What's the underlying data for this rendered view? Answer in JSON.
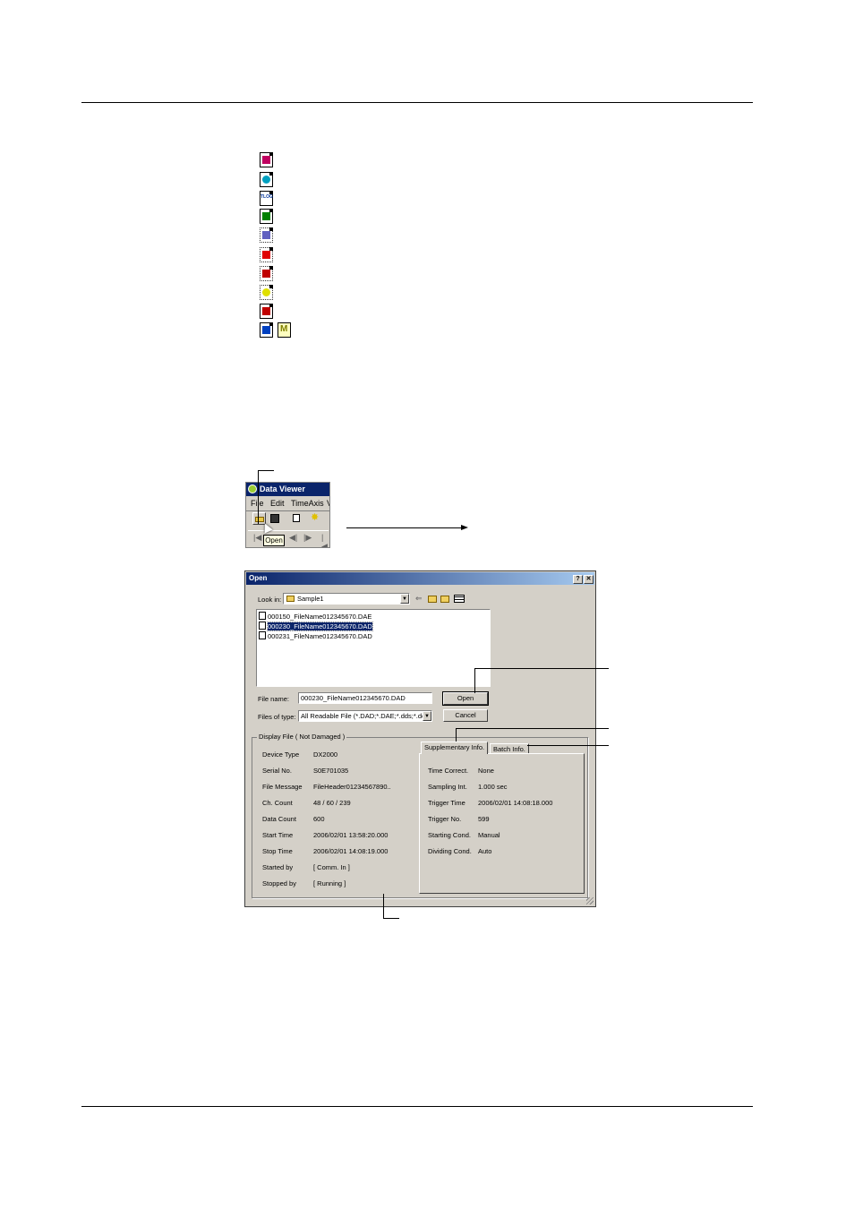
{
  "file_icons": [
    {
      "name": "data-file-icon",
      "glyph_color": "#c00060"
    },
    {
      "name": "database-file-icon",
      "glyph_color": "#00a0c0"
    },
    {
      "name": "tlog-file-icon",
      "glyph_color": "#003399"
    },
    {
      "name": "chart-file-icon",
      "glyph_color": "#008000"
    },
    {
      "name": "dotted-file-icon",
      "glyph_color": "#6060c0"
    },
    {
      "name": "alarm-file-icon",
      "glyph_color": "#e00000"
    },
    {
      "name": "event-file-icon",
      "glyph_color": "#c00000"
    },
    {
      "name": "yellow-file-icon",
      "glyph_color": "#e0e000"
    },
    {
      "name": "marker-file-icon",
      "glyph_color": "#c00000"
    },
    {
      "name": "blue-file-icon",
      "glyph_color": "#0040c0"
    },
    {
      "name": "manual-file-icon",
      "glyph_color": "#808000"
    }
  ],
  "icon_texts": {
    "tlog": "TLOG",
    "manual": "M"
  },
  "data_viewer": {
    "title": "Data Viewer",
    "menu": [
      "File",
      "Edit",
      "TimeAxis",
      "V"
    ],
    "tooltip": "Open",
    "title_color": "#0a246a"
  },
  "dialog": {
    "title": "Open",
    "help_glyph": "?",
    "close_glyph": "✕",
    "look_in_label": "Look in:",
    "look_in_value": "Sample1",
    "files": [
      {
        "name": "000150_FileName012345670.DAE",
        "selected": false
      },
      {
        "name": "000230_FileName012345670.DAD",
        "selected": true
      },
      {
        "name": "000231_FileName012345670.DAD",
        "selected": false
      }
    ],
    "file_name_label": "File name:",
    "file_name_value": "000230_FileName012345670.DAD",
    "files_of_type_label": "Files of type:",
    "files_of_type_value": "All Readable File (*.DAD;*.DAE;*.dds;*.dev",
    "open_button": "Open",
    "cancel_button": "Cancel",
    "display_file_caption": "Display File ( Not Damaged )",
    "display_fields": [
      {
        "label": "Device Type",
        "value": "DX2000"
      },
      {
        "label": "Serial No.",
        "value": "S0E701035"
      },
      {
        "label": "File Message",
        "value": "FileHeader01234567890.."
      },
      {
        "label": "Ch. Count",
        "value": "48 / 60 / 239"
      },
      {
        "label": "Data Count",
        "value": "600"
      },
      {
        "label": "Start Time",
        "value": "2006/02/01 13:58:20.000"
      },
      {
        "label": "Stop Time",
        "value": "2006/02/01 14:08:19.000"
      },
      {
        "label": "Started by",
        "value": "[ Comm. In ]"
      },
      {
        "label": "Stopped by",
        "value": "[ Running ]"
      }
    ],
    "tabs": [
      "Supplementary Info.",
      "Batch Info."
    ],
    "supplementary_fields": [
      {
        "label": "Time Correct.",
        "value": "None"
      },
      {
        "label": "Sampling Int.",
        "value": "1.000 sec"
      },
      {
        "label": "Trigger Time",
        "value": "2006/02/01 14:08:18.000"
      },
      {
        "label": "Trigger No.",
        "value": "599"
      },
      {
        "label": "Starting Cond.",
        "value": "Manual"
      },
      {
        "label": "Dividing Cond.",
        "value": "Auto"
      }
    ]
  },
  "colors": {
    "dialog_bg": "#d4d0c8",
    "selection": "#0a246a",
    "title_gradient_end": "#a6caf0"
  }
}
